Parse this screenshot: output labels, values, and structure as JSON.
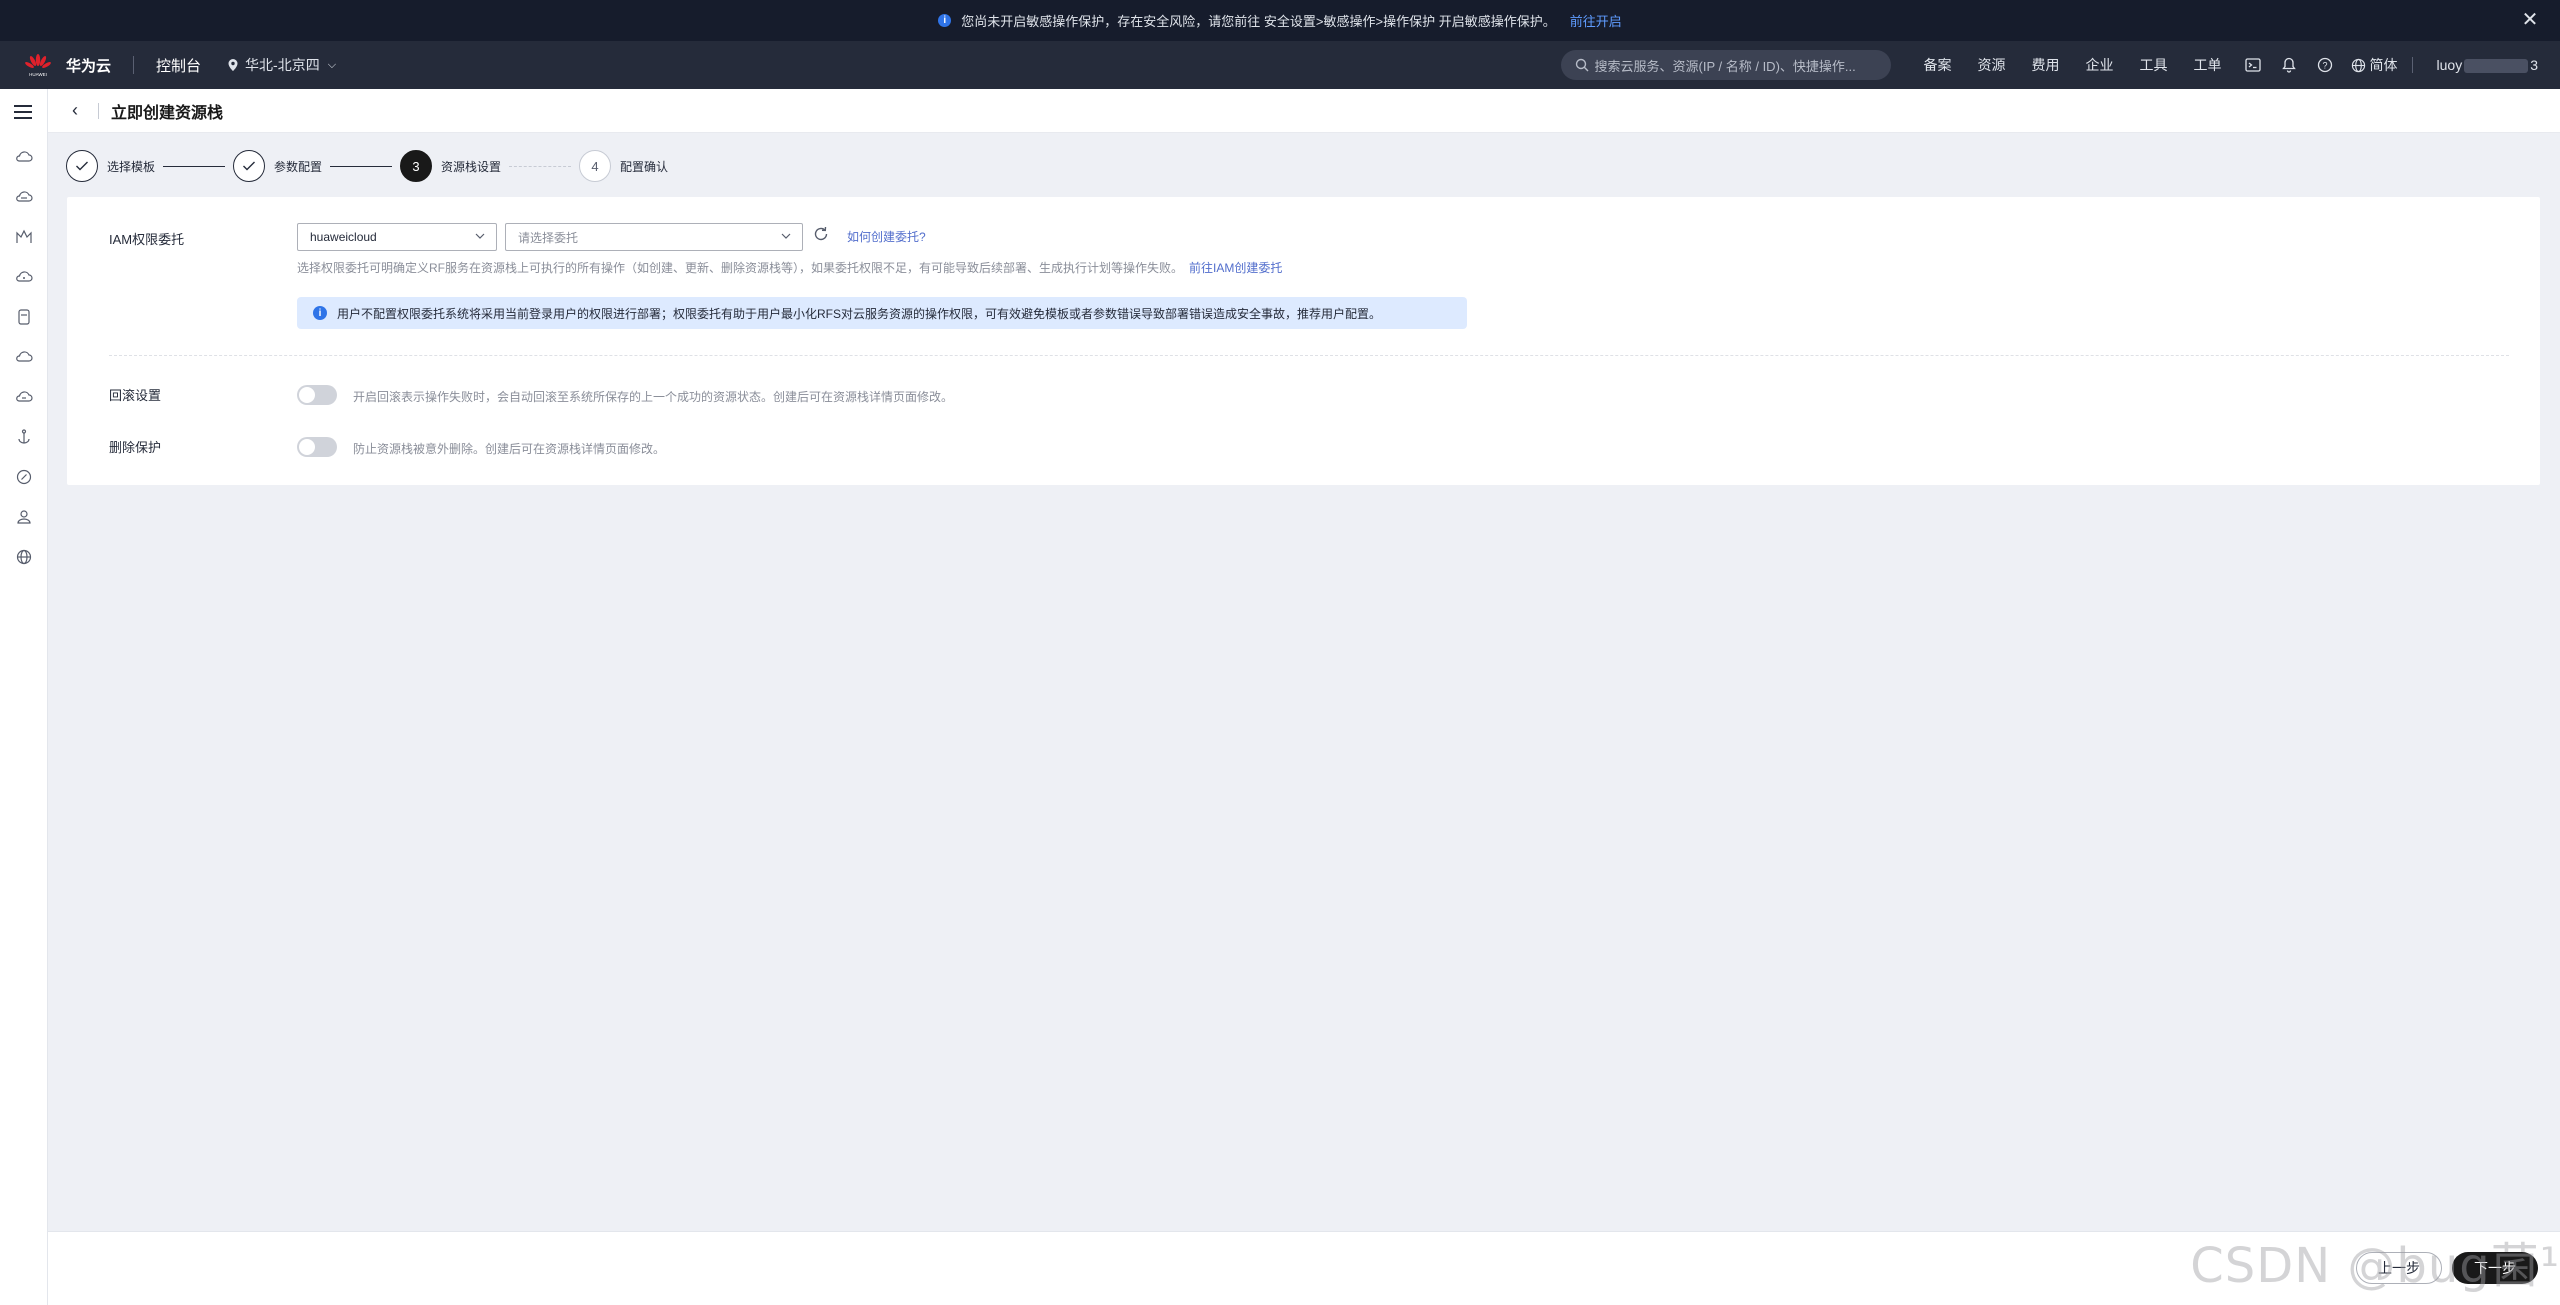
{
  "banner": {
    "message": "您尚未开启敏感操作保护，存在安全风险，请您前往 安全设置>敏感操作>操作保护 开启敏感操作保护。",
    "link": "前往开启",
    "close_icon": "close-icon"
  },
  "topnav": {
    "brand_small": "HUAWEI",
    "brand": "华为云",
    "console": "控制台",
    "region": "华北-北京四",
    "search_placeholder": "搜索云服务、资源(IP / 名称 / ID)、快捷操作...",
    "links": [
      "备案",
      "资源",
      "费用",
      "企业",
      "工具",
      "工单"
    ],
    "lang": "简体",
    "user_prefix": "luoy",
    "user_suffix": "3"
  },
  "page": {
    "title": "立即创建资源栈"
  },
  "steps": [
    {
      "label": "选择模板",
      "status": "done"
    },
    {
      "label": "参数配置",
      "status": "done"
    },
    {
      "label": "资源栈设置",
      "number": "3",
      "status": "active"
    },
    {
      "label": "配置确认",
      "number": "4",
      "status": "pending"
    }
  ],
  "form": {
    "iam_label": "IAM权限委托",
    "provider_value": "huaweicloud",
    "delegation_placeholder": "请选择委托",
    "help_link": "如何创建委托?",
    "hint": "选择权限委托可明确定义RF服务在资源栈上可执行的所有操作（如创建、更新、删除资源栈等），如果委托权限不足，有可能导致后续部署、生成执行计划等操作失败。",
    "hint_link": "前往IAM创建委托",
    "alert": "用户不配置权限委托系统将采用当前登录用户的权限进行部署；权限委托有助于用户最小化RFS对云服务资源的操作权限，可有效避免模板或者参数错误导致部署错误造成安全事故，推荐用户配置。",
    "rollback_label": "回滚设置",
    "rollback_desc": "开启回滚表示操作失败时，会自动回滚至系统所保存的上一个成功的资源状态。创建后可在资源栈详情页面修改。",
    "rollback_enabled": false,
    "delete_label": "删除保护",
    "delete_desc": "防止资源栈被意外删除。创建后可在资源栈详情页面修改。",
    "delete_enabled": false
  },
  "footer": {
    "prev": "上一步",
    "next": "下一步"
  },
  "watermark": "CSDN @bug菌¹",
  "colors": {
    "banner_bg": "#161c2c",
    "nav_bg": "#252b3a",
    "link": "#526ecc",
    "alert_bg": "#ddeaff",
    "active_step": "#191919"
  }
}
